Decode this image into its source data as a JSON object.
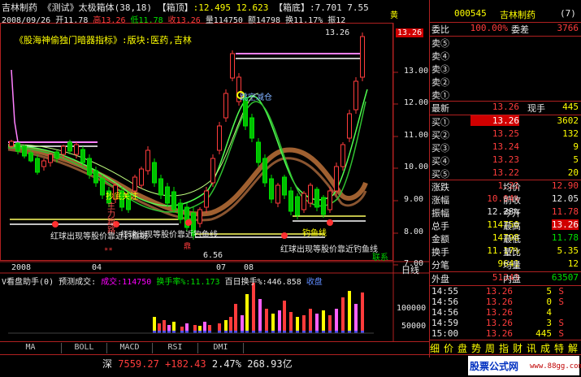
{
  "header": {
    "stock": "吉林制药",
    "indicator": "《测试》太极箱体(38,18)",
    "box_top_label": "【箱顶】",
    "box_top_values": ":12.495  12.623",
    "box_bottom_label": "【箱底】",
    "box_bottom_values": ":7.701  7.55",
    "side_mark": "黄"
  },
  "quote_line": {
    "date": "2008/09/26",
    "open": "开11.78",
    "high": "高13.26",
    "low": "低11.78",
    "close": "收13.26",
    "volume": "量114750",
    "amount": "额14798",
    "turnover": "换11.17%",
    "amplitude": "振12"
  },
  "title_line": "《股海神偷独门暗器指标》:版块:医药,吉林",
  "price_axis": [
    "13.00",
    "12.00",
    "11.00",
    "10.00",
    "9.00",
    "8.00",
    "7.00"
  ],
  "top_price_label": "13.26",
  "top_price_box": "13.26",
  "min_price_label": "6.56",
  "annotations": {
    "tiao": "跳空减仓",
    "zhubi": "主力跑路",
    "buy1": "抄底关注",
    "red1": "红球出现等股价靠近钓鱼线",
    "red2": "红球出现等股价靠近钓鱼线",
    "red3": "红球出现等股价靠近钓鱼线",
    "mid1": "钓鱼线",
    "stars": "**",
    "ding": "鼎",
    "lian": "联系"
  },
  "date_axis": {
    "d1": "2008",
    "d2": "04",
    "d3": "07",
    "d4": "08"
  },
  "day_label": "日线",
  "vol_panel": {
    "title": "V看盘助手",
    "zero": "(0)",
    "pred": "预测成交:",
    "vol_label": "成交:114750",
    "turn_label": "换手率%",
    "turn_val": ":11.173",
    "turn100": "百日换手%:446.858",
    "shou": "收盘",
    "axis_100000": "100000",
    "axis_50000": "50000"
  },
  "tabs": [
    "MA",
    "BOLL",
    "MACD",
    "RSI",
    "DMI"
  ],
  "bottom": {
    "index": "深",
    "index_val": "7559.27",
    "change": "+182.43",
    "pct": "2.47%",
    "amount": "268.93亿",
    "logo": "股票公式网",
    "site": "www.88gg.com"
  },
  "right": {
    "code": "000545",
    "name": "吉林制药",
    "seven": "(7)",
    "webi_label": "委比",
    "webi": "100.00%",
    "weicha_label": "委差",
    "weicha": "3766",
    "sell": [
      {
        "label": "卖⑤",
        "price": "",
        "vol": ""
      },
      {
        "label": "卖④",
        "price": "",
        "vol": ""
      },
      {
        "label": "卖③",
        "price": "",
        "vol": ""
      },
      {
        "label": "卖②",
        "price": "",
        "vol": ""
      },
      {
        "label": "卖①",
        "price": "",
        "vol": ""
      }
    ],
    "latest_label": "最新",
    "latest": "13.26",
    "xianshou_label": "现手",
    "xianshou": "445",
    "buy": [
      {
        "label": "买①",
        "price": "13.26",
        "vol": "3602"
      },
      {
        "label": "买②",
        "price": "13.25",
        "vol": "132"
      },
      {
        "label": "买③",
        "price": "13.24",
        "vol": "9"
      },
      {
        "label": "买④",
        "price": "13.23",
        "vol": "5"
      },
      {
        "label": "买⑤",
        "price": "13.22",
        "vol": "20"
      }
    ],
    "stats": [
      {
        "l": "涨跌",
        "v": "1.21",
        "l2": "均价",
        "v2": "12.90"
      },
      {
        "l": "涨幅",
        "v": "10.04%",
        "l2": "前收",
        "v2": "12.05"
      },
      {
        "l": "振幅",
        "v": "12.28%",
        "l2": "今开",
        "v2": "11.78"
      },
      {
        "l": "总手",
        "v": "114750",
        "l2": "最高",
        "v2": "13.26"
      },
      {
        "l": "金额",
        "v": "14798",
        "l2": "最低",
        "v2": "11.78"
      },
      {
        "l": "换手",
        "v": "11.17%",
        "l2": "量比",
        "v2": "5.35"
      },
      {
        "l": "分笔",
        "v": "9641",
        "l2": "均量",
        "v2": "12"
      }
    ],
    "waipan_label": "外盘",
    "waipan": "51243",
    "neipan_label": "内盘",
    "neipan": "63507",
    "ticks": [
      {
        "t": "14:55",
        "p": "13.26",
        "v": "5",
        "s": "S"
      },
      {
        "t": "14:56",
        "p": "13.26",
        "v": "0",
        "s": "S"
      },
      {
        "t": "14:56",
        "p": "13.26",
        "v": "4",
        "s": ""
      },
      {
        "t": "14:59",
        "p": "13.26",
        "v": "3",
        "s": "S"
      },
      {
        "t": "15:00",
        "p": "13.26",
        "v": "445",
        "s": "S"
      }
    ],
    "bottom_tabs": [
      "细",
      "价",
      "盘",
      "势",
      "周",
      "指",
      "财",
      "讯",
      "成",
      "特",
      "解"
    ]
  },
  "colors": {
    "up": "#ff3c3c",
    "down": "#00e000",
    "bg": "#000000",
    "grid": "#b02020"
  }
}
